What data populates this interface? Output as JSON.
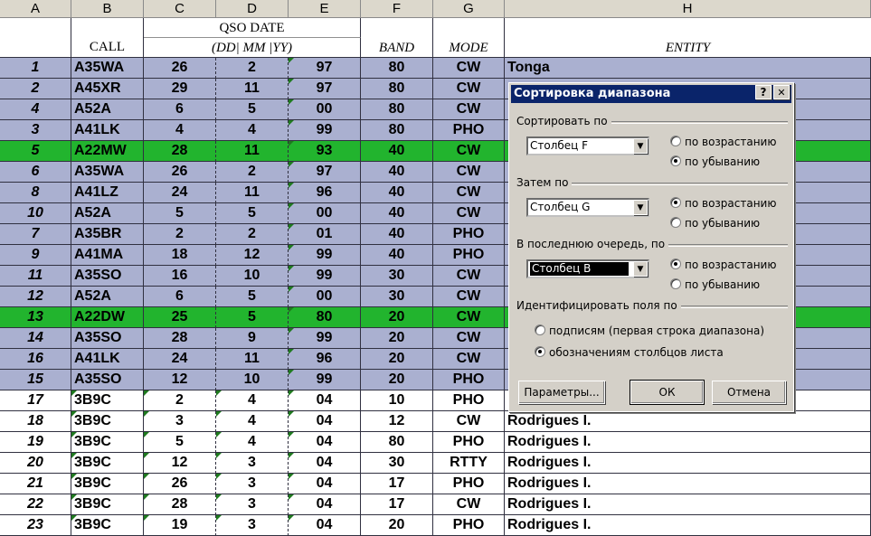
{
  "columns": [
    "A",
    "B",
    "C",
    "D",
    "E",
    "F",
    "G",
    "H"
  ],
  "header": {
    "call": "CALL",
    "qso_date": "QSO DATE",
    "date_sub": "(DD|  MM |YY)",
    "band": "BAND",
    "mode": "MODE",
    "entity": "ENTITY"
  },
  "rows": [
    {
      "n": "1",
      "call": "A35WA",
      "dd": "26",
      "mm": "2",
      "yy": "97",
      "band": "80",
      "mode": "CW",
      "entity": "Tonga",
      "style": "sel"
    },
    {
      "n": "2",
      "call": "A45XR",
      "dd": "29",
      "mm": "11",
      "yy": "97",
      "band": "80",
      "mode": "CW",
      "entity": "",
      "style": "sel"
    },
    {
      "n": "4",
      "call": "A52A",
      "dd": "6",
      "mm": "5",
      "yy": "00",
      "band": "80",
      "mode": "CW",
      "entity": "",
      "style": "sel"
    },
    {
      "n": "3",
      "call": "A41LK",
      "dd": "4",
      "mm": "4",
      "yy": "99",
      "band": "80",
      "mode": "PHO",
      "entity": "",
      "style": "sel"
    },
    {
      "n": "5",
      "call": "A22MW",
      "dd": "28",
      "mm": "11",
      "yy": "93",
      "band": "40",
      "mode": "CW",
      "entity": "",
      "style": "green"
    },
    {
      "n": "6",
      "call": "A35WA",
      "dd": "26",
      "mm": "2",
      "yy": "97",
      "band": "40",
      "mode": "CW",
      "entity": "",
      "style": "sel"
    },
    {
      "n": "8",
      "call": "A41LZ",
      "dd": "24",
      "mm": "11",
      "yy": "96",
      "band": "40",
      "mode": "CW",
      "entity": "",
      "style": "sel"
    },
    {
      "n": "10",
      "call": "A52A",
      "dd": "5",
      "mm": "5",
      "yy": "00",
      "band": "40",
      "mode": "CW",
      "entity": "",
      "style": "sel"
    },
    {
      "n": "7",
      "call": "A35BR",
      "dd": "2",
      "mm": "2",
      "yy": "01",
      "band": "40",
      "mode": "PHO",
      "entity": "",
      "style": "sel"
    },
    {
      "n": "9",
      "call": "A41MA",
      "dd": "18",
      "mm": "12",
      "yy": "99",
      "band": "40",
      "mode": "PHO",
      "entity": "",
      "style": "sel"
    },
    {
      "n": "11",
      "call": "A35SO",
      "dd": "16",
      "mm": "10",
      "yy": "99",
      "band": "30",
      "mode": "CW",
      "entity": "",
      "style": "sel"
    },
    {
      "n": "12",
      "call": "A52A",
      "dd": "6",
      "mm": "5",
      "yy": "00",
      "band": "30",
      "mode": "CW",
      "entity": "",
      "style": "sel"
    },
    {
      "n": "13",
      "call": "A22DW",
      "dd": "25",
      "mm": "5",
      "yy": "80",
      "band": "20",
      "mode": "CW",
      "entity": "",
      "style": "green"
    },
    {
      "n": "14",
      "call": "A35SO",
      "dd": "28",
      "mm": "9",
      "yy": "99",
      "band": "20",
      "mode": "CW",
      "entity": "",
      "style": "sel"
    },
    {
      "n": "16",
      "call": "A41LK",
      "dd": "24",
      "mm": "11",
      "yy": "96",
      "band": "20",
      "mode": "CW",
      "entity": "",
      "style": "sel"
    },
    {
      "n": "15",
      "call": "A35SO",
      "dd": "12",
      "mm": "10",
      "yy": "99",
      "band": "20",
      "mode": "PHO",
      "entity": "",
      "style": "sel"
    },
    {
      "n": "17",
      "call": "3B9C",
      "dd": "2",
      "mm": "4",
      "yy": "04",
      "band": "10",
      "mode": "PHO",
      "entity": "",
      "style": "plain"
    },
    {
      "n": "18",
      "call": "3B9C",
      "dd": "3",
      "mm": "4",
      "yy": "04",
      "band": "12",
      "mode": "CW",
      "entity": "Rodrigues I.",
      "style": "plain"
    },
    {
      "n": "19",
      "call": "3B9C",
      "dd": "5",
      "mm": "4",
      "yy": "04",
      "band": "80",
      "mode": "PHO",
      "entity": "Rodrigues I.",
      "style": "plain"
    },
    {
      "n": "20",
      "call": "3B9C",
      "dd": "12",
      "mm": "3",
      "yy": "04",
      "band": "30",
      "mode": "RTTY",
      "entity": "Rodrigues I.",
      "style": "plain"
    },
    {
      "n": "21",
      "call": "3B9C",
      "dd": "26",
      "mm": "3",
      "yy": "04",
      "band": "17",
      "mode": "PHO",
      "entity": "Rodrigues I.",
      "style": "plain"
    },
    {
      "n": "22",
      "call": "3B9C",
      "dd": "28",
      "mm": "3",
      "yy": "04",
      "band": "17",
      "mode": "CW",
      "entity": "Rodrigues I.",
      "style": "plain"
    },
    {
      "n": "23",
      "call": "3B9C",
      "dd": "19",
      "mm": "3",
      "yy": "04",
      "band": "20",
      "mode": "PHO",
      "entity": "Rodrigues I.",
      "style": "plain"
    }
  ],
  "colors": {
    "selected": "#aab0d0",
    "green": "#22b42e",
    "plain": "#ffffff"
  },
  "dialog": {
    "title": "Сортировка диапазона",
    "help": "?",
    "close": "✕",
    "sort_by_label": "Сортировать по",
    "sort_by_value": "Столбец F",
    "then_by_label": "Затем по",
    "then_by_value": "Столбец G",
    "last_by_label": "В последнюю очередь, по",
    "last_by_value": "Столбец B",
    "asc": "по возрастанию",
    "desc": "по убыванию",
    "identify_label": "Идентифицировать поля по",
    "by_labels": "подписям (первая строка диапазона)",
    "by_columns": "обозначениям столбцов листа",
    "params": "Параметры...",
    "ok": "ОК",
    "cancel": "Отмена"
  }
}
